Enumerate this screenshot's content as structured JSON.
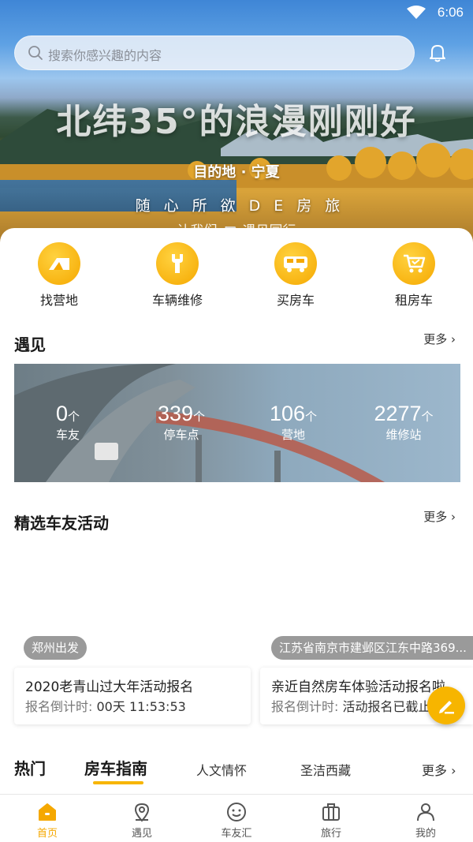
{
  "status_bar": {
    "time": "6:06"
  },
  "search": {
    "placeholder": "搜索你感兴趣的内容"
  },
  "hero": {
    "title": "北纬35°的浪漫刚刚好",
    "destination": "目的地 · 宁夏",
    "slogan": "随心所欲DE房旅",
    "slogan2": "让我们 🚐 遇见同行"
  },
  "quick_actions": [
    {
      "label": "找营地",
      "icon": "tent-icon"
    },
    {
      "label": "车辆维修",
      "icon": "wrench-icon"
    },
    {
      "label": "买房车",
      "icon": "rv-icon"
    },
    {
      "label": "租房车",
      "icon": "cart-icon"
    }
  ],
  "encounter": {
    "title": "遇见",
    "more": "更多",
    "stats": [
      {
        "value": "0",
        "unit": "个",
        "label": "车友"
      },
      {
        "value": "339",
        "unit": "个",
        "label": "停车点"
      },
      {
        "value": "106",
        "unit": "个",
        "label": "营地"
      },
      {
        "value": "2277",
        "unit": "个",
        "label": "维修站"
      }
    ]
  },
  "activities": {
    "title": "精选车友活动",
    "more": "更多",
    "items": [
      {
        "location": "郑州出发",
        "title": "2020老青山过大年活动报名",
        "countdown_label": "报名倒计时:",
        "countdown_value": "00天 11:53:53"
      },
      {
        "location": "江苏省南京市建邺区江东中路369...",
        "title": "亲近自然房车体验活动报名啦",
        "countdown_label": "报名倒计时:",
        "countdown_value": "活动报名已截止"
      }
    ]
  },
  "guide_tabs": {
    "hot": "热门",
    "tabs": [
      "房车指南",
      "人文情怀",
      "圣洁西藏"
    ],
    "active_index": 0,
    "more": "更多"
  },
  "bottom_nav": [
    {
      "label": "首页",
      "icon": "home-icon",
      "active": true
    },
    {
      "label": "遇见",
      "icon": "location-icon",
      "active": false
    },
    {
      "label": "车友汇",
      "icon": "smile-icon",
      "active": false
    },
    {
      "label": "旅行",
      "icon": "suitcase-icon",
      "active": false
    },
    {
      "label": "我的",
      "icon": "user-icon",
      "active": false
    }
  ],
  "colors": {
    "accent": "#f5a800",
    "accent_light": "#ffd23f"
  }
}
